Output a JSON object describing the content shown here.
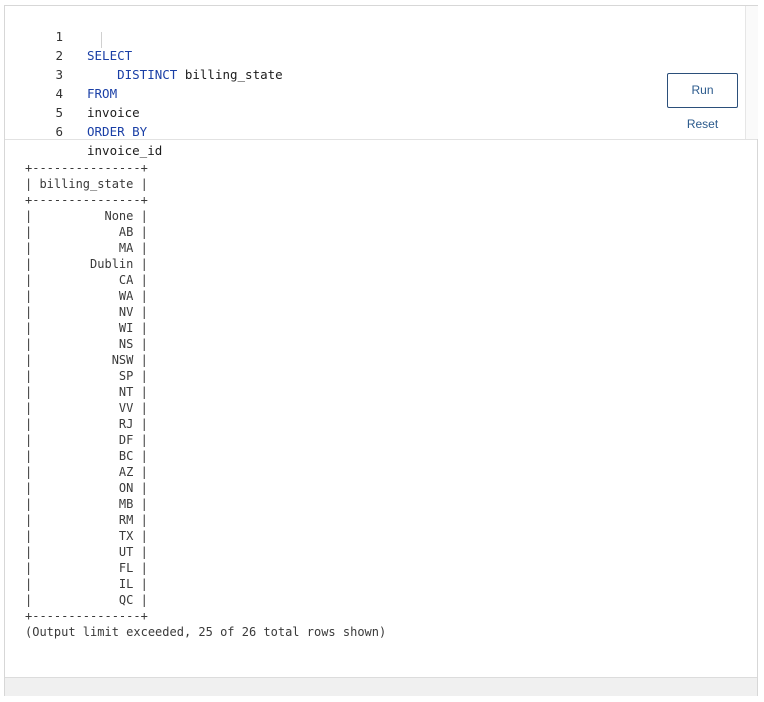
{
  "editor": {
    "lines": [
      {
        "num": "1",
        "text": "SELECT"
      },
      {
        "num": "2",
        "text": "    DISTINCT",
        "text2": " billing_state"
      },
      {
        "num": "3",
        "text": "FROM"
      },
      {
        "num": "4",
        "text": "invoice"
      },
      {
        "num": "5",
        "text": "ORDER BY"
      },
      {
        "num": "6",
        "text": "invoice_id"
      }
    ]
  },
  "buttons": {
    "run_label": "Run",
    "reset_label": "Reset"
  },
  "output": {
    "border_line": "+---------------+",
    "header_line": "| billing_state |",
    "column_header": "billing_state",
    "rows": [
      "None",
      "AB",
      "MA",
      "Dublin",
      "CA",
      "WA",
      "NV",
      "WI",
      "NS",
      "NSW",
      "SP",
      "NT",
      "VV",
      "RJ",
      "DF",
      "BC",
      "AZ",
      "ON",
      "MB",
      "RM",
      "TX",
      "UT",
      "FL",
      "IL",
      "QC"
    ],
    "status": "(Output limit exceeded, 25 of 26 total rows shown)"
  },
  "colors": {
    "keyword": "#1a3fa6",
    "button_text": "#2b5a8c"
  }
}
